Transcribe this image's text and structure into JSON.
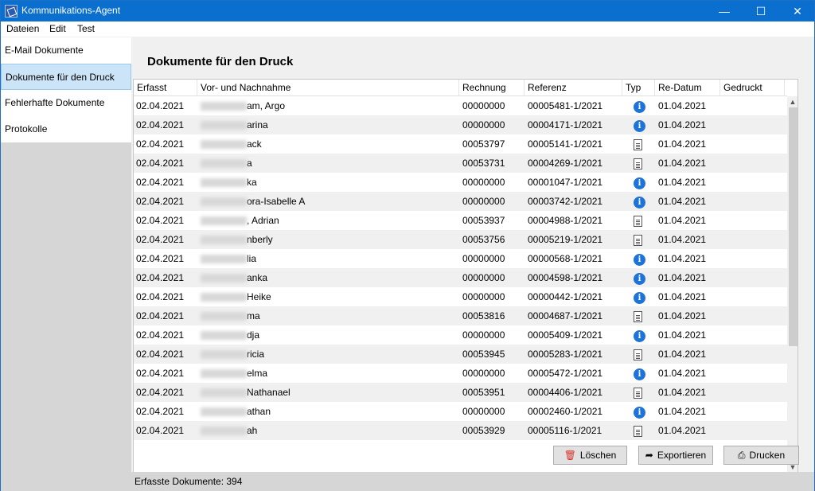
{
  "window": {
    "title": "Kommunikations-Agent",
    "min": "—",
    "max": "☐",
    "close": "✕"
  },
  "menu": [
    "Dateien",
    "Edit",
    "Test"
  ],
  "sidebar": {
    "items": [
      {
        "label": "E-Mail Dokumente",
        "active": false
      },
      {
        "label": "Dokumente für den Druck",
        "active": true
      },
      {
        "label": "Fehlerhafte Dokumente",
        "active": false
      },
      {
        "label": "Protokolle",
        "active": false
      }
    ]
  },
  "main": {
    "title": "Dokumente für den Druck"
  },
  "table": {
    "headers": [
      "Erfasst",
      "Vor- und Nachnahme",
      "Rechnung",
      "Referenz",
      "Typ",
      "Re-Datum",
      "Gedruckt"
    ],
    "rows": [
      {
        "erfasst": "02.04.2021",
        "name": "am, Argo",
        "rechnung": "00000000",
        "referenz": "00005481-1/2021",
        "typ": "info-icon",
        "redatum": "01.04.2021",
        "gedruckt": ""
      },
      {
        "erfasst": "02.04.2021",
        "name": "arina",
        "rechnung": "00000000",
        "referenz": "00004171-1/2021",
        "typ": "info-icon",
        "redatum": "01.04.2021",
        "gedruckt": ""
      },
      {
        "erfasst": "02.04.2021",
        "name": "ack",
        "rechnung": "00053797",
        "referenz": "00005141-1/2021",
        "typ": "document-icon",
        "redatum": "01.04.2021",
        "gedruckt": ""
      },
      {
        "erfasst": "02.04.2021",
        "name": "a",
        "rechnung": "00053731",
        "referenz": "00004269-1/2021",
        "typ": "document-icon",
        "redatum": "01.04.2021",
        "gedruckt": ""
      },
      {
        "erfasst": "02.04.2021",
        "name": "ka",
        "rechnung": "00000000",
        "referenz": "00001047-1/2021",
        "typ": "info-icon",
        "redatum": "01.04.2021",
        "gedruckt": ""
      },
      {
        "erfasst": "02.04.2021",
        "name": "ora-Isabelle A",
        "rechnung": "00000000",
        "referenz": "00003742-1/2021",
        "typ": "info-icon",
        "redatum": "01.04.2021",
        "gedruckt": ""
      },
      {
        "erfasst": "02.04.2021",
        "name": ", Adrian",
        "rechnung": "00053937",
        "referenz": "00004988-1/2021",
        "typ": "document-icon",
        "redatum": "01.04.2021",
        "gedruckt": ""
      },
      {
        "erfasst": "02.04.2021",
        "name": "nberly",
        "rechnung": "00053756",
        "referenz": "00005219-1/2021",
        "typ": "document-icon",
        "redatum": "01.04.2021",
        "gedruckt": ""
      },
      {
        "erfasst": "02.04.2021",
        "name": "lia",
        "rechnung": "00000000",
        "referenz": "00000568-1/2021",
        "typ": "info-icon",
        "redatum": "01.04.2021",
        "gedruckt": ""
      },
      {
        "erfasst": "02.04.2021",
        "name": "anka",
        "rechnung": "00000000",
        "referenz": "00004598-1/2021",
        "typ": "info-icon",
        "redatum": "01.04.2021",
        "gedruckt": ""
      },
      {
        "erfasst": "02.04.2021",
        "name": "Heike",
        "rechnung": "00000000",
        "referenz": "00000442-1/2021",
        "typ": "info-icon",
        "redatum": "01.04.2021",
        "gedruckt": ""
      },
      {
        "erfasst": "02.04.2021",
        "name": "ma",
        "rechnung": "00053816",
        "referenz": "00004687-1/2021",
        "typ": "document-icon",
        "redatum": "01.04.2021",
        "gedruckt": ""
      },
      {
        "erfasst": "02.04.2021",
        "name": "dja",
        "rechnung": "00000000",
        "referenz": "00005409-1/2021",
        "typ": "info-icon",
        "redatum": "01.04.2021",
        "gedruckt": ""
      },
      {
        "erfasst": "02.04.2021",
        "name": "ricia",
        "rechnung": "00053945",
        "referenz": "00005283-1/2021",
        "typ": "document-icon",
        "redatum": "01.04.2021",
        "gedruckt": ""
      },
      {
        "erfasst": "02.04.2021",
        "name": "elma",
        "rechnung": "00000000",
        "referenz": "00005472-1/2021",
        "typ": "info-icon",
        "redatum": "01.04.2021",
        "gedruckt": ""
      },
      {
        "erfasst": "02.04.2021",
        "name": "Nathanael",
        "rechnung": "00053951",
        "referenz": "00004406-1/2021",
        "typ": "document-icon",
        "redatum": "01.04.2021",
        "gedruckt": ""
      },
      {
        "erfasst": "02.04.2021",
        "name": "athan",
        "rechnung": "00000000",
        "referenz": "00002460-1/2021",
        "typ": "info-icon",
        "redatum": "01.04.2021",
        "gedruckt": ""
      },
      {
        "erfasst": "02.04.2021",
        "name": "ah",
        "rechnung": "00053929",
        "referenz": "00005116-1/2021",
        "typ": "document-icon",
        "redatum": "01.04.2021",
        "gedruckt": ""
      }
    ]
  },
  "buttons": {
    "delete": "Löschen",
    "export": "Exportieren",
    "print": "Drucken"
  },
  "status": {
    "text": "Erfasste Dokumente: 394"
  },
  "colors": {
    "titlebar": "#0b6fd0",
    "selection": "#cce4f7",
    "info": "#1e73d8",
    "delete": "#d9342b"
  }
}
